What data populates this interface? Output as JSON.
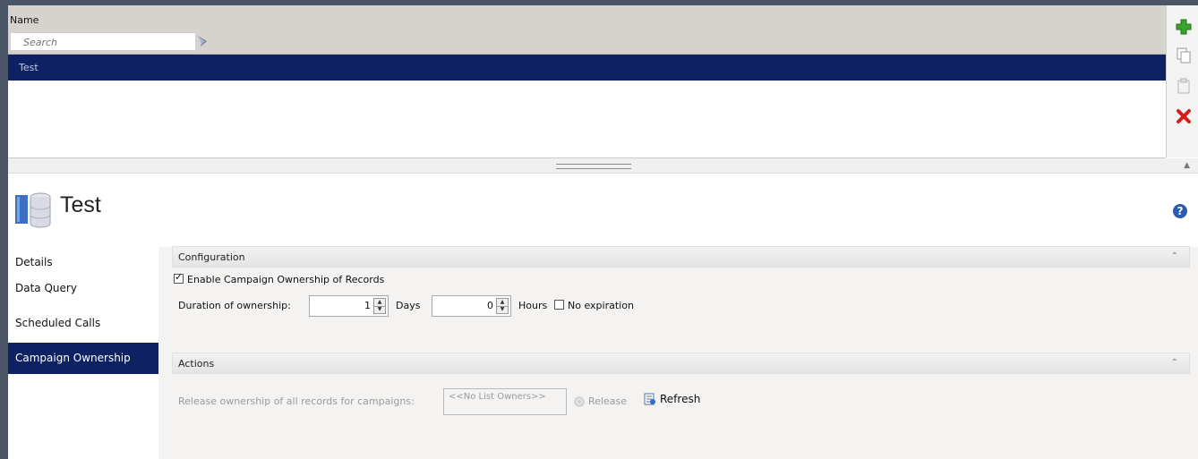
{
  "list": {
    "column_name": "Name",
    "search_placeholder": "Search",
    "rows": [
      {
        "name": "Test",
        "selected": true
      }
    ]
  },
  "toolbar": {
    "icons": [
      "add-icon",
      "copy-icon",
      "paste-icon",
      "delete-icon"
    ]
  },
  "detail": {
    "title": "Test",
    "icon": "database-icon"
  },
  "nav": {
    "items": [
      {
        "label": "Details",
        "active": false
      },
      {
        "label": "Data Query",
        "active": false
      },
      {
        "label": "Scheduled Calls",
        "active": false
      },
      {
        "label": "Campaign Ownership",
        "active": true
      }
    ]
  },
  "configuration": {
    "section_label": "Configuration",
    "enable_label": "Enable Campaign Ownership of Records",
    "enable_checked": true,
    "duration_label": "Duration of ownership:",
    "days_value": "1",
    "days_unit": "Days",
    "hours_value": "0",
    "hours_unit": "Hours",
    "no_expiration_label": "No expiration",
    "no_expiration_checked": false
  },
  "actions": {
    "section_label": "Actions",
    "release_label": "Release ownership of all records for campaigns:",
    "owners_placeholder": "<<No List Owners>>",
    "release_button": "Release",
    "refresh_button": "Refresh"
  },
  "colors": {
    "selection": "#0e2163",
    "header_bg": "#d6d3ce",
    "content_bg": "#f4f3f2"
  }
}
